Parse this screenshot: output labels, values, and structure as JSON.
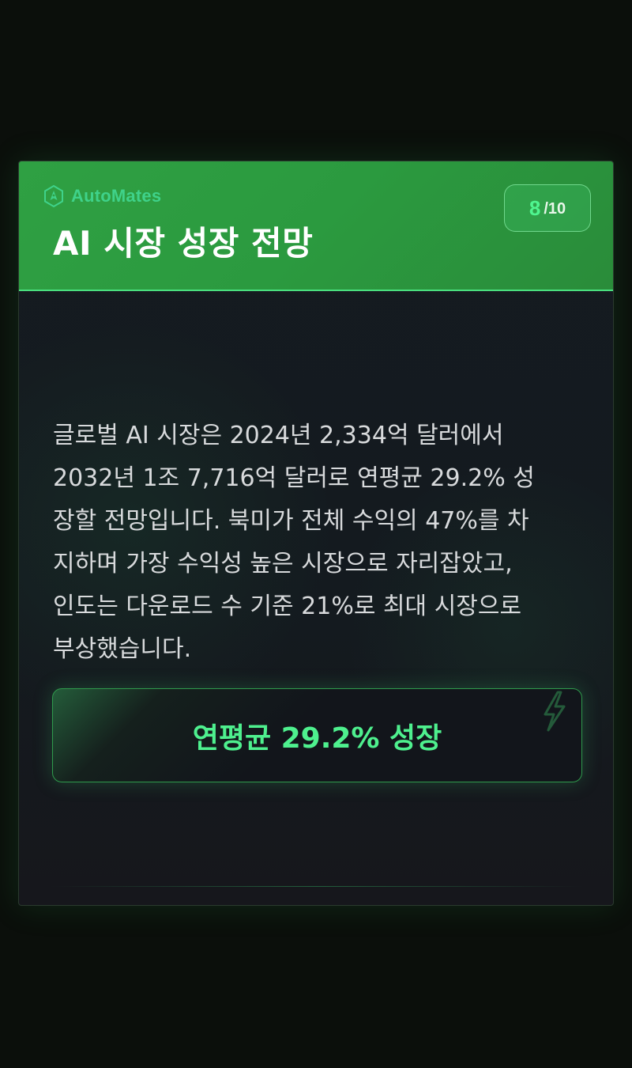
{
  "header": {
    "brand_name": "AutoMates",
    "title": "AI 시장 성장 전망",
    "page_current": "8",
    "page_total": "/10"
  },
  "content": {
    "body": "글로벌 AI 시장은 2024년 2,334억 달러에서\n2032년 1조 7,716억 달러로 연평균 29.2% 성\n장할 전망입니다. 북미가 전체 수익의 47%를 차\n지하며 가장 수익성 높은 시장으로 자리잡았고,\n인도는 다운로드 수 기준 21%로 최대 시장으로\n부상했습니다.",
    "highlight": "연평균 29.2% 성장"
  },
  "icons": {
    "brand": "hexagon-logo-icon",
    "bolt": "lightning-bolt-icon"
  },
  "colors": {
    "header_green": "#2fa043",
    "accent_green": "#4ef08e",
    "brand_teal": "#3fd28a",
    "background": "#0b0f0b"
  }
}
